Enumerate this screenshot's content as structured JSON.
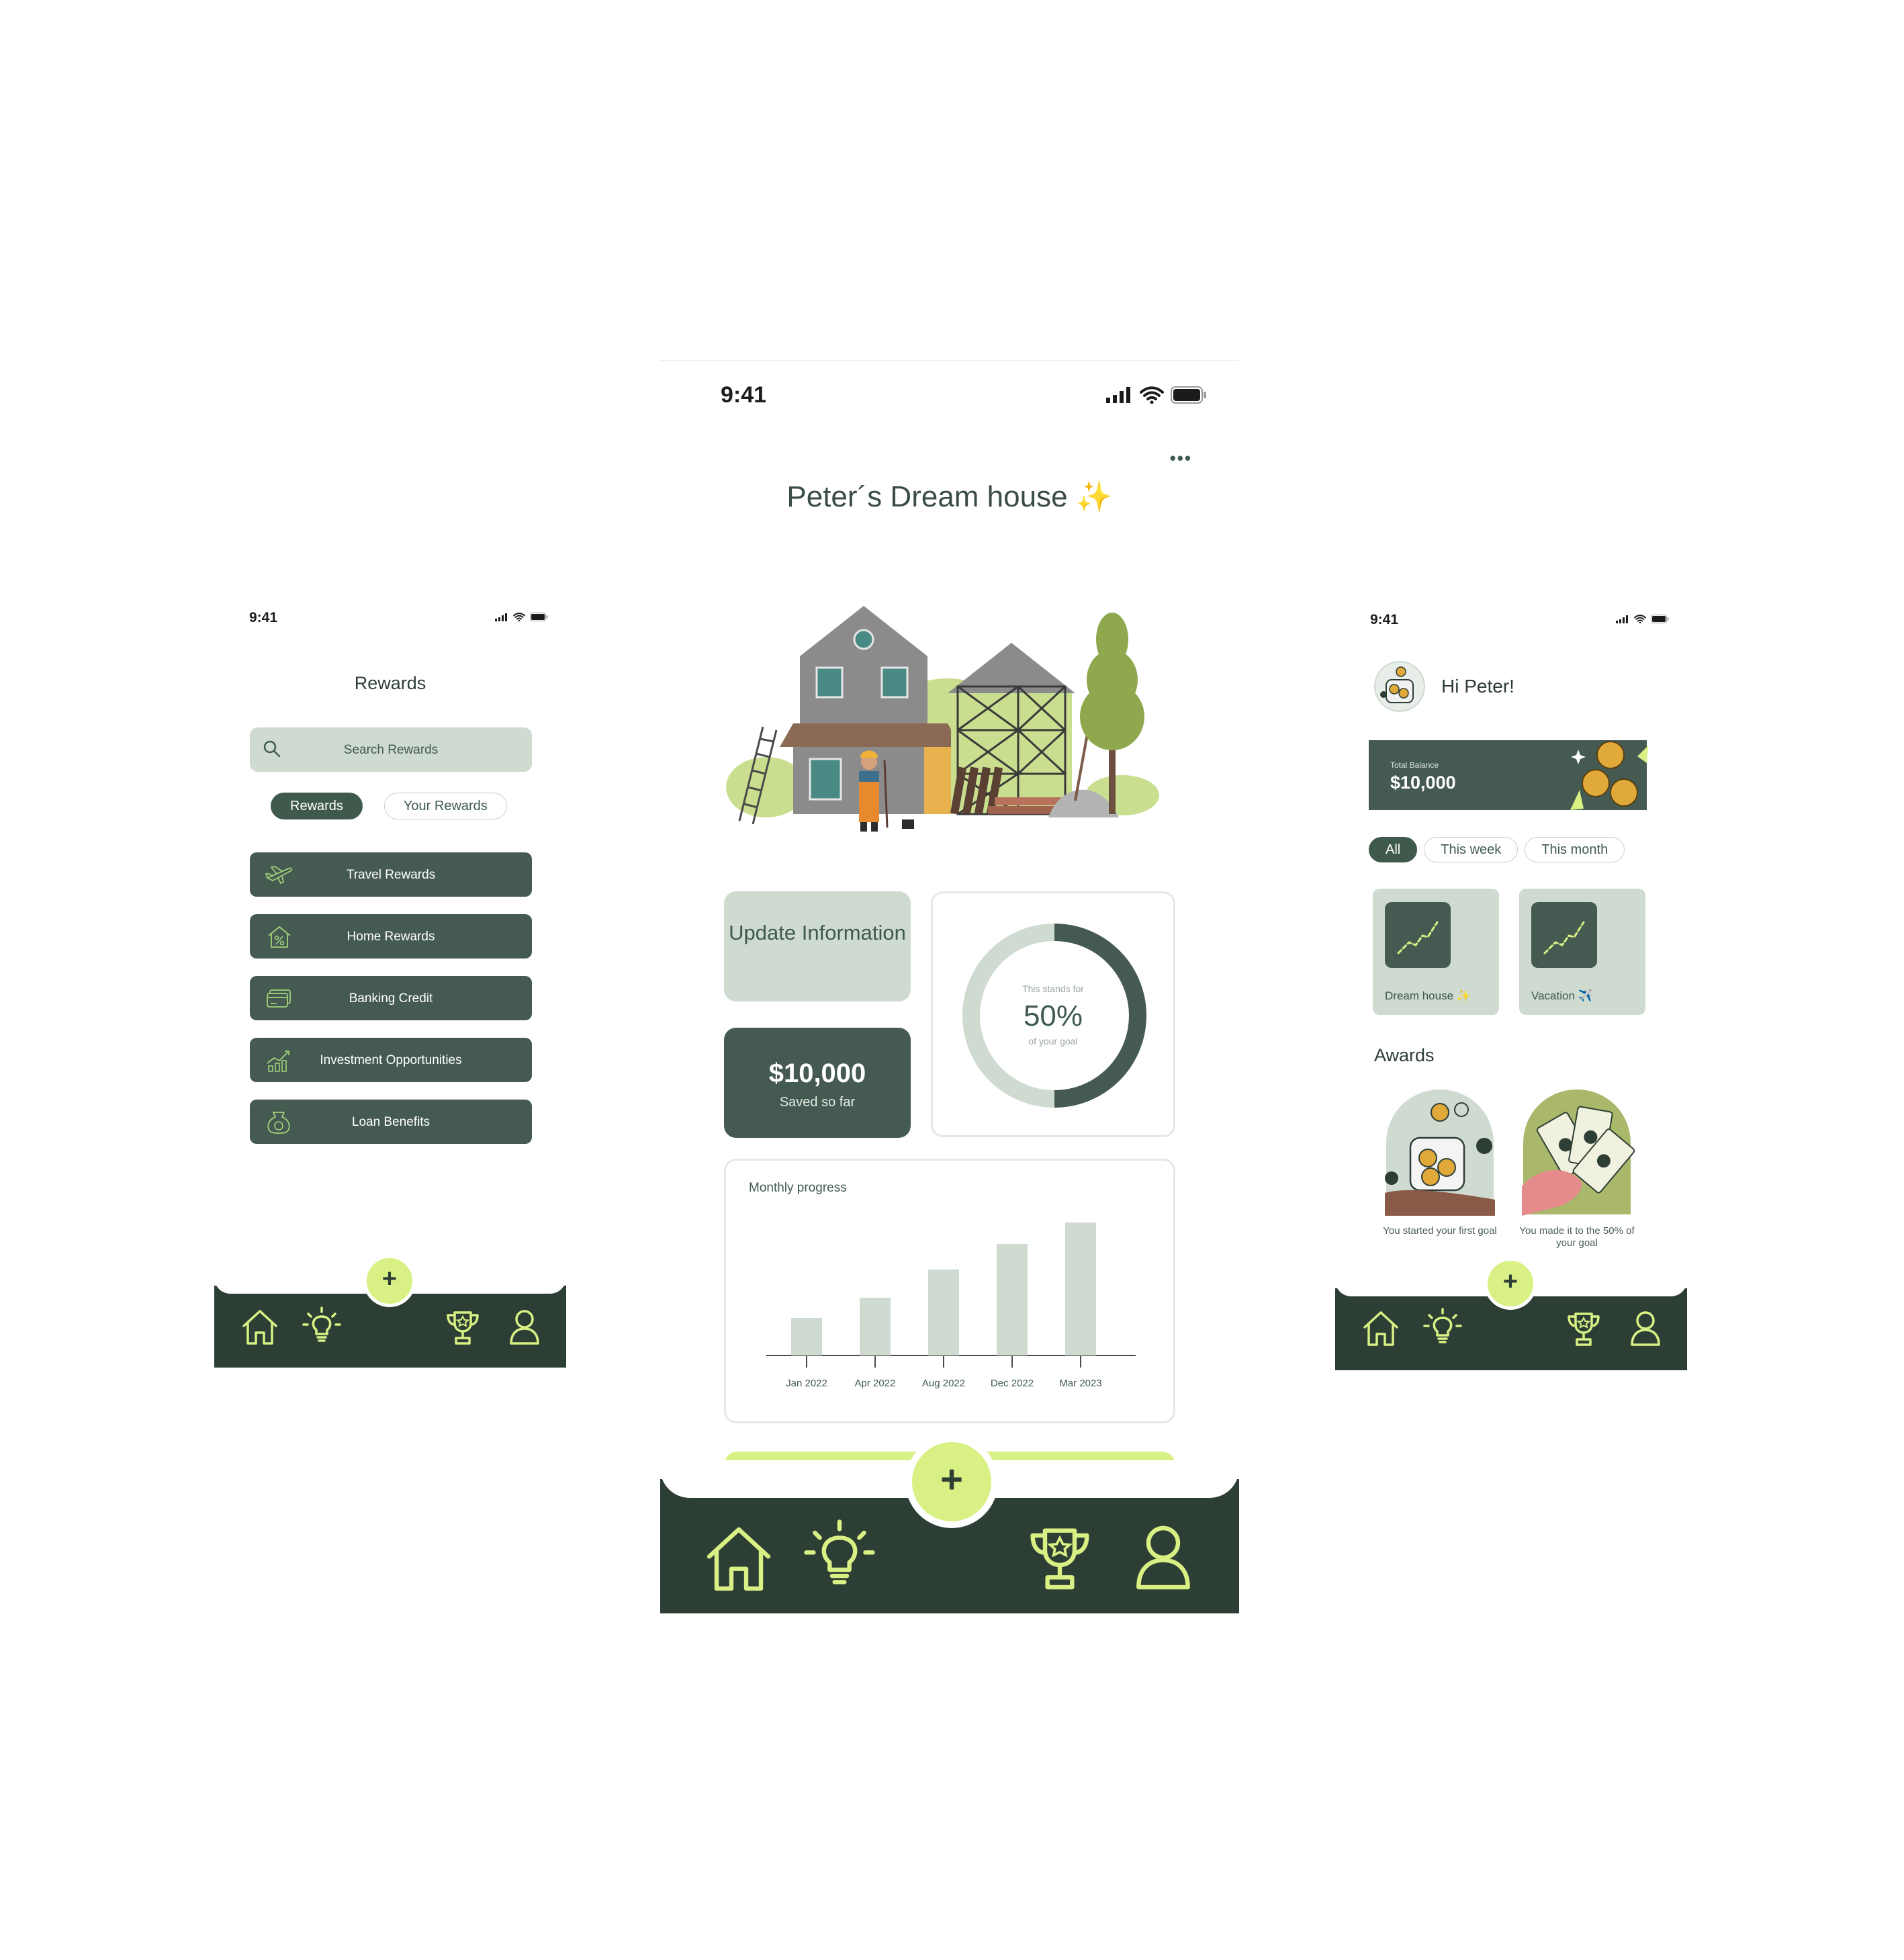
{
  "colors": {
    "dark_green": "#2d3e35",
    "mid_green": "#455a51",
    "sage": "#cfdad1",
    "lime": "#d9f184"
  },
  "left_screen": {
    "status_time": "9:41",
    "title": "Rewards",
    "search_placeholder": "Search Rewards",
    "tabs": [
      "Rewards",
      "Your Rewards"
    ],
    "active_tab": "Rewards",
    "items": [
      {
        "label": "Travel Rewards",
        "icon": "airplane-icon"
      },
      {
        "label": "Home Rewards",
        "icon": "home-percent-icon"
      },
      {
        "label": "Banking Credit",
        "icon": "credit-card-icon"
      },
      {
        "label": "Investment Opportunities",
        "icon": "investment-growth-icon"
      },
      {
        "label": "Loan Benefits",
        "icon": "money-bag-icon"
      }
    ],
    "fab_label": "+"
  },
  "center_screen": {
    "status_time": "9:41",
    "menu_dots": "•••",
    "title": "Peter´s Dream house",
    "title_emoji": "✨",
    "update_button": "Update Information",
    "saved_amount": "$10,000",
    "saved_caption": "Saved so far",
    "donut": {
      "caption_top": "This stands for",
      "percent_text": "50%",
      "caption_bottom": "of your goal",
      "value": 0.5
    },
    "fab_label": "+"
  },
  "chart_data": {
    "type": "bar",
    "title": "Monthly progress",
    "categories": [
      "Jan 2022",
      "Apr 2022",
      "Aug 2022",
      "Dec 2022",
      "Mar 2023"
    ],
    "values": [
      28,
      43,
      64,
      83,
      99
    ],
    "xlabel": "",
    "ylabel": "",
    "ylim": [
      0,
      100
    ],
    "grid": false,
    "legend": "none"
  },
  "right_screen": {
    "status_time": "9:41",
    "greeting": "Hi Peter!",
    "balance_label": "Total Balance",
    "balance_value": "$10,000",
    "filters": [
      "All",
      "This week",
      "This month"
    ],
    "active_filter": "All",
    "goals": [
      {
        "label": "Dream house",
        "emoji": "✨"
      },
      {
        "label": "Vacation",
        "emoji": "✈️"
      }
    ],
    "awards_title": "Awards",
    "awards": [
      {
        "caption": "You started your first goal"
      },
      {
        "caption": "You made it to the 50% of your goal"
      }
    ],
    "fab_label": "+"
  },
  "nav_icons": [
    "home-icon",
    "lightbulb-icon",
    "trophy-icon",
    "profile-icon"
  ]
}
